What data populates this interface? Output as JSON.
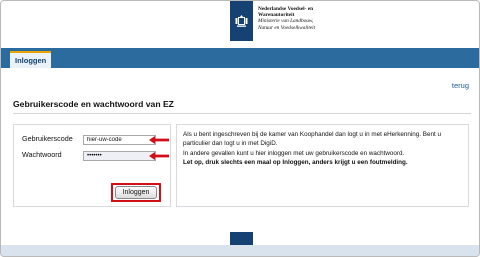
{
  "header": {
    "logo_lines": [
      "Nederlandse Voedsel- en",
      "Warenautoriteit",
      "Ministerie van Landbouw,",
      "Natuur en Voedselkwaliteit"
    ],
    "brand_color": "#154273",
    "band_color": "#2b6b9d"
  },
  "nav": {
    "active_tab": "Inloggen"
  },
  "back_link": "terug",
  "page_title": "Gebruikerscode en wachtwoord van EZ",
  "login": {
    "username_label": "Gebruikerscode",
    "username_value": "hier-uw-code",
    "password_label": "Wachtwoord",
    "password_value": "•••••••",
    "submit_label": "Inloggen",
    "highlight_color": "#d40e17"
  },
  "info": {
    "line1": "Als u bent ingeschreven bij de kamer van Koophandel dan logt u in met eHerkenning. Bent u particulier dan logt u in met DigiD.",
    "line2": "In andere gevallen kunt u hier inloggen met uw gebruikerscode en wachtwoord.",
    "line3": "Let op, druk slechts een maal op Inloggen, anders krijgt u een foutmelding."
  }
}
